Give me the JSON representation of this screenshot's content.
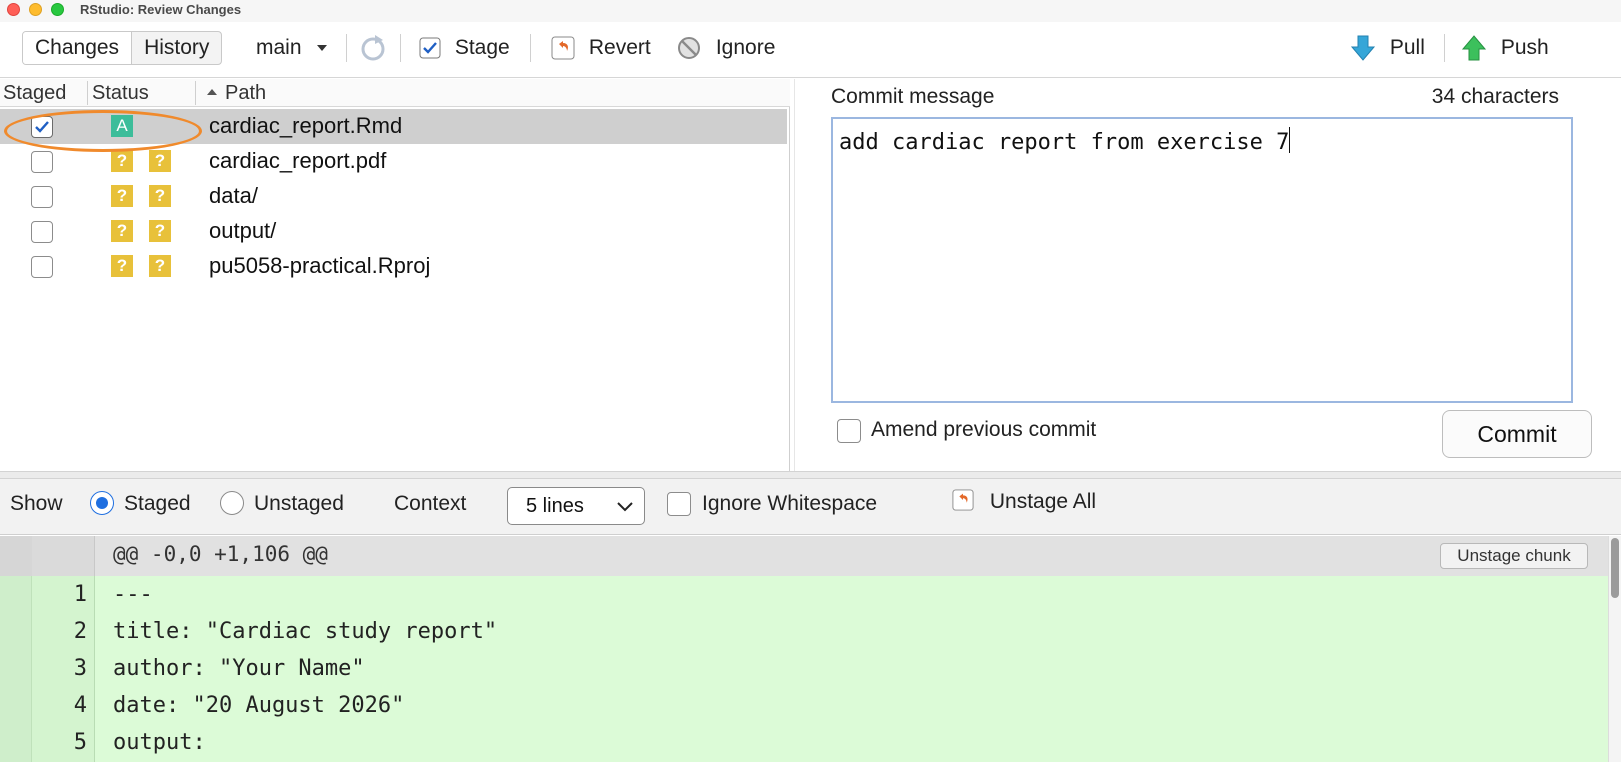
{
  "window": {
    "title": "RStudio: Review Changes"
  },
  "toolbar": {
    "changes_tab": "Changes",
    "history_tab": "History",
    "branch": "main",
    "stage_label": "Stage",
    "revert_label": "Revert",
    "ignore_label": "Ignore",
    "pull_label": "Pull",
    "push_label": "Push"
  },
  "file_list": {
    "columns": {
      "staged": "Staged",
      "status": "Status",
      "path": "Path"
    },
    "rows": [
      {
        "path": "cardiac_report.Rmd",
        "staged": true,
        "status": [
          "A"
        ],
        "selected": true
      },
      {
        "path": "cardiac_report.pdf",
        "staged": false,
        "status": [
          "?",
          "?"
        ],
        "selected": false
      },
      {
        "path": "data/",
        "staged": false,
        "status": [
          "?",
          "?"
        ],
        "selected": false
      },
      {
        "path": "output/",
        "staged": false,
        "status": [
          "?",
          "?"
        ],
        "selected": false
      },
      {
        "path": "pu5058-practical.Rproj",
        "staged": false,
        "status": [
          "?",
          "?"
        ],
        "selected": false
      }
    ]
  },
  "commit": {
    "label": "Commit message",
    "char_count": "34 characters",
    "message": "add cardiac report from exercise 7",
    "amend_label": "Amend previous commit",
    "amend_checked": false,
    "commit_button": "Commit"
  },
  "diff_toolbar": {
    "show_label": "Show",
    "staged_label": "Staged",
    "unstaged_label": "Unstaged",
    "mode": "staged",
    "context_label": "Context",
    "context_value": "5 lines",
    "ignore_ws_label": "Ignore Whitespace",
    "ignore_ws_checked": false,
    "unstage_all_label": "Unstage All"
  },
  "diff": {
    "hunk_header": "@@ -0,0 +1,106 @@",
    "unstage_chunk_label": "Unstage chunk",
    "lines": [
      {
        "num": "1",
        "text": "---"
      },
      {
        "num": "2",
        "text": "title: \"Cardiac study report\""
      },
      {
        "num": "3",
        "text": "author: \"Your Name\""
      },
      {
        "num": "4",
        "text": "date: \"20 August 2026\""
      },
      {
        "num": "5",
        "text": "output:"
      }
    ]
  },
  "colors": {
    "staged_badge": "#3dbd9a",
    "untracked_badge": "#e8c13a",
    "added_line_bg": "#dcfbd7",
    "highlight_ring": "#f08a2c",
    "radio_accent": "#1f6fe0"
  }
}
